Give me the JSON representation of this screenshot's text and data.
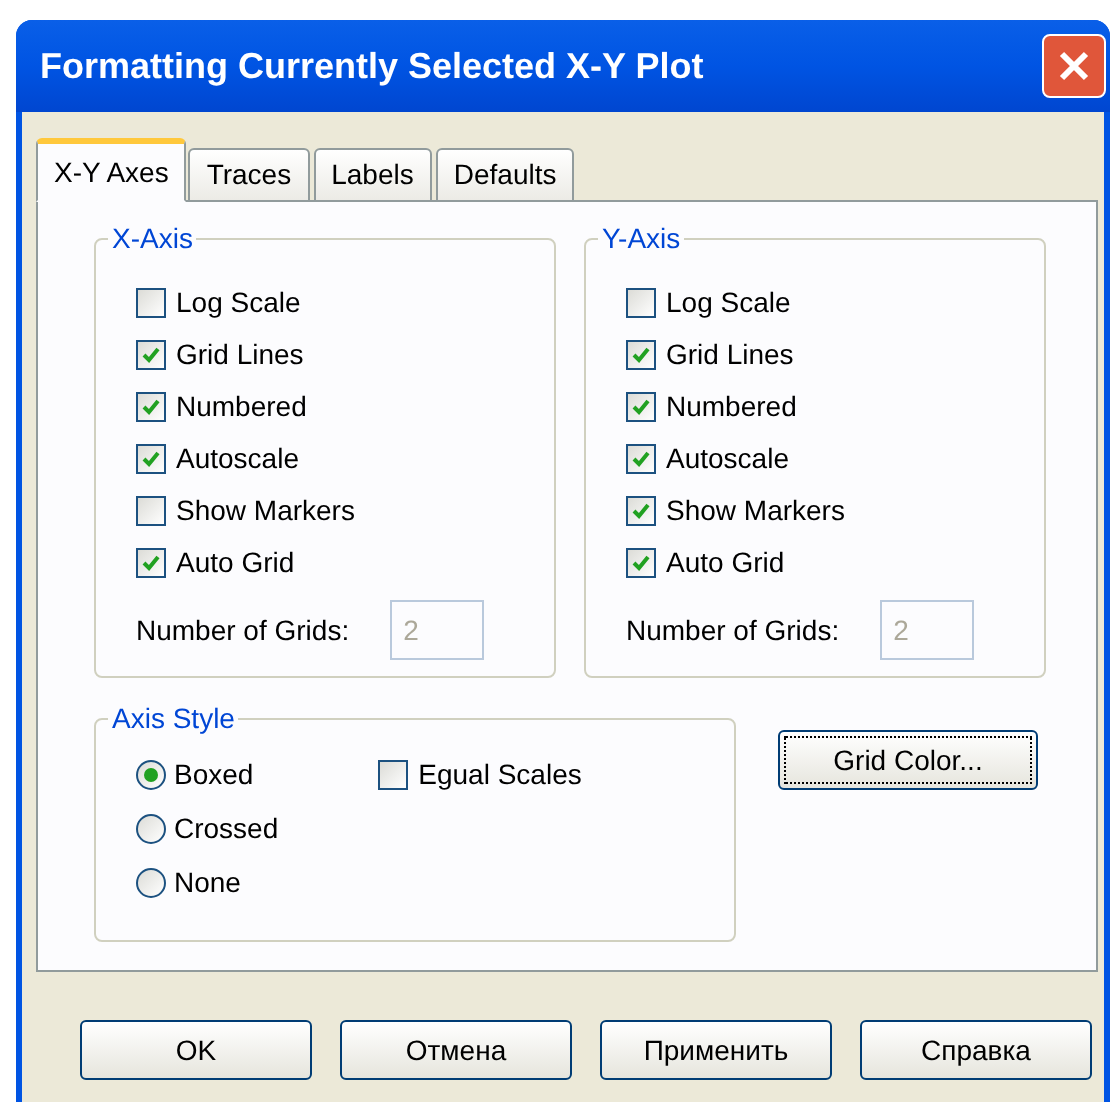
{
  "window": {
    "title": "Formatting Currently Selected X-Y Plot"
  },
  "tabs": [
    {
      "label": "X-Y Axes",
      "selected": true
    },
    {
      "label": "Traces",
      "selected": false
    },
    {
      "label": "Labels",
      "selected": false
    },
    {
      "label": "Defaults",
      "selected": false
    }
  ],
  "axes": [
    {
      "title": "X-Axis",
      "options": [
        {
          "label": "Log Scale",
          "checked": false
        },
        {
          "label": "Grid Lines",
          "checked": true
        },
        {
          "label": "Numbered",
          "checked": true
        },
        {
          "label": "Autoscale",
          "checked": true
        },
        {
          "label": "Show Markers",
          "checked": false
        },
        {
          "label": "Auto Grid",
          "checked": true
        }
      ],
      "grids": {
        "label": "Number of Grids:",
        "value": "2",
        "disabled": true
      }
    },
    {
      "title": "Y-Axis",
      "options": [
        {
          "label": "Log Scale",
          "checked": false
        },
        {
          "label": "Grid Lines",
          "checked": true
        },
        {
          "label": "Numbered",
          "checked": true
        },
        {
          "label": "Autoscale",
          "checked": true
        },
        {
          "label": "Show Markers",
          "checked": true
        },
        {
          "label": "Auto Grid",
          "checked": true
        }
      ],
      "grids": {
        "label": "Number of Grids:",
        "value": "2",
        "disabled": true
      }
    }
  ],
  "axis_style": {
    "title": "Axis Style",
    "options": [
      {
        "label": "Boxed",
        "selected": true
      },
      {
        "label": "Crossed",
        "selected": false
      },
      {
        "label": "None",
        "selected": false
      }
    ],
    "equal_scales": {
      "label": "Egual Scales",
      "checked": false
    }
  },
  "grid_color_button": {
    "label": "Grid Color..."
  },
  "buttons": [
    {
      "label": "OK"
    },
    {
      "label": "Отмена"
    },
    {
      "label": "Применить"
    },
    {
      "label": "Справка"
    }
  ]
}
